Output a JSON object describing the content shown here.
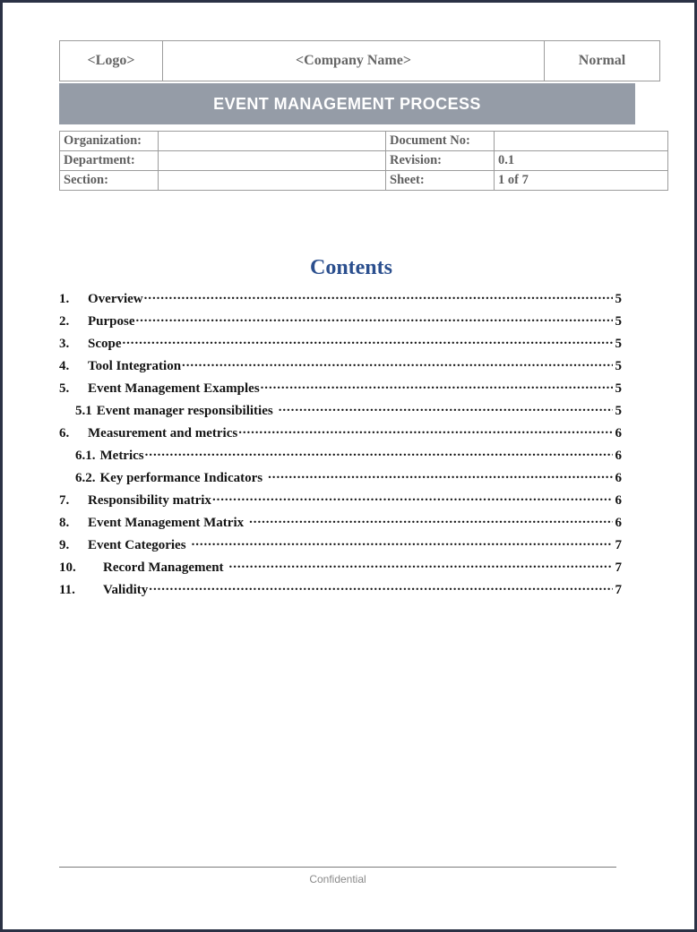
{
  "header": {
    "logo_cell": "<Logo>",
    "company_cell": "<Company Name>",
    "status_cell": "Normal"
  },
  "title_bar": {
    "title": "EVENT MANAGEMENT PROCESS",
    "background_color": "#959ca7",
    "text_color": "#ffffff"
  },
  "meta": {
    "rows": [
      {
        "label_left": "Organization:",
        "value_left": "",
        "label_right": "Document No:",
        "value_right": ""
      },
      {
        "label_left": "Department:",
        "value_left": "",
        "label_right": "Revision:",
        "value_right": "0.1"
      },
      {
        "label_left": "Section:",
        "value_left": "",
        "label_right": "Sheet:",
        "value_right": "1 of 7"
      }
    ]
  },
  "contents": {
    "heading": "Contents",
    "heading_color": "#2b4f8e",
    "entries": [
      {
        "number": "1.",
        "label": "Overview",
        "page": "5",
        "level": 1
      },
      {
        "number": "2.",
        "label": "Purpose",
        "page": "5",
        "level": 1
      },
      {
        "number": "3.",
        "label": "Scope",
        "page": "5",
        "level": 1
      },
      {
        "number": "4.",
        "label": "Tool Integration",
        "page": "5",
        "level": 1
      },
      {
        "number": "5.",
        "label": "Event Management Examples",
        "page": "5",
        "level": 1
      },
      {
        "number": "5.1",
        "label": "Event manager responsibilities",
        "page": "5",
        "level": 2
      },
      {
        "number": "6.",
        "label": "Measurement and metrics",
        "page": "6",
        "level": 1
      },
      {
        "number": "6.1.",
        "label": "Metrics",
        "page": "6",
        "level": 2
      },
      {
        "number": "6.2.",
        "label": "Key performance Indicators",
        "page": "6",
        "level": 2
      },
      {
        "number": "7.",
        "label": "Responsibility matrix",
        "page": "6",
        "level": 1
      },
      {
        "number": "8.",
        "label": "Event Management Matrix",
        "page": "6",
        "level": 1
      },
      {
        "number": "9.",
        "label": "Event Categories",
        "page": "7",
        "level": 1
      },
      {
        "number": "10.",
        "label": "Record Management",
        "page": "7",
        "level": 1
      },
      {
        "number": "11.",
        "label": "Validity",
        "page": "7",
        "level": 1
      }
    ]
  },
  "footer": {
    "text": "Confidential"
  }
}
